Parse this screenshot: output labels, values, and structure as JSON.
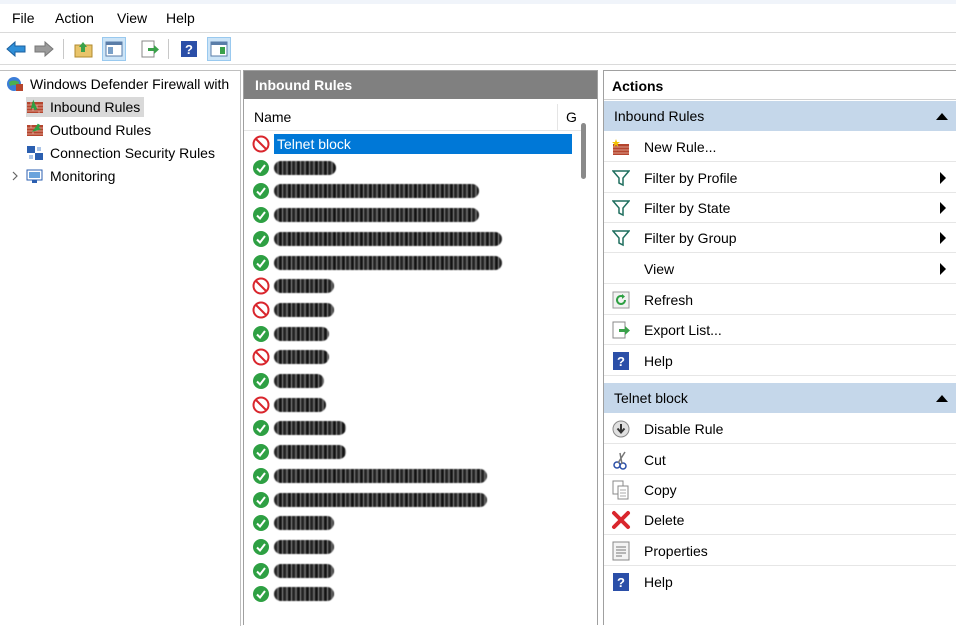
{
  "menu": [
    "File",
    "Action",
    "View",
    "Help"
  ],
  "tree": {
    "root": "Windows Defender Firewall with",
    "items": [
      "Inbound Rules",
      "Outbound Rules",
      "Connection Security Rules",
      "Monitoring"
    ]
  },
  "middle": {
    "header": "Inbound Rules",
    "columns": [
      "Name",
      "G"
    ],
    "selected_rule": "Telnet block",
    "rows_status": [
      "block",
      "allow",
      "allow",
      "allow",
      "allow",
      "allow",
      "block",
      "block",
      "allow",
      "block",
      "allow",
      "block",
      "allow",
      "allow",
      "allow",
      "allow",
      "allow",
      "allow",
      "allow",
      "allow"
    ]
  },
  "actions": {
    "title": "Actions",
    "section1": "Inbound Rules",
    "section1_items": [
      "New Rule...",
      "Filter by Profile",
      "Filter by State",
      "Filter by Group",
      "View",
      "Refresh",
      "Export List...",
      "Help"
    ],
    "section2": "Telnet block",
    "section2_items": [
      "Disable Rule",
      "Cut",
      "Copy",
      "Delete",
      "Properties",
      "Help"
    ]
  },
  "colors": {
    "selection": "#0078d7",
    "section_bg": "#c5d7ea",
    "allow_green": "#2ea043",
    "block_red": "#d9262d"
  }
}
